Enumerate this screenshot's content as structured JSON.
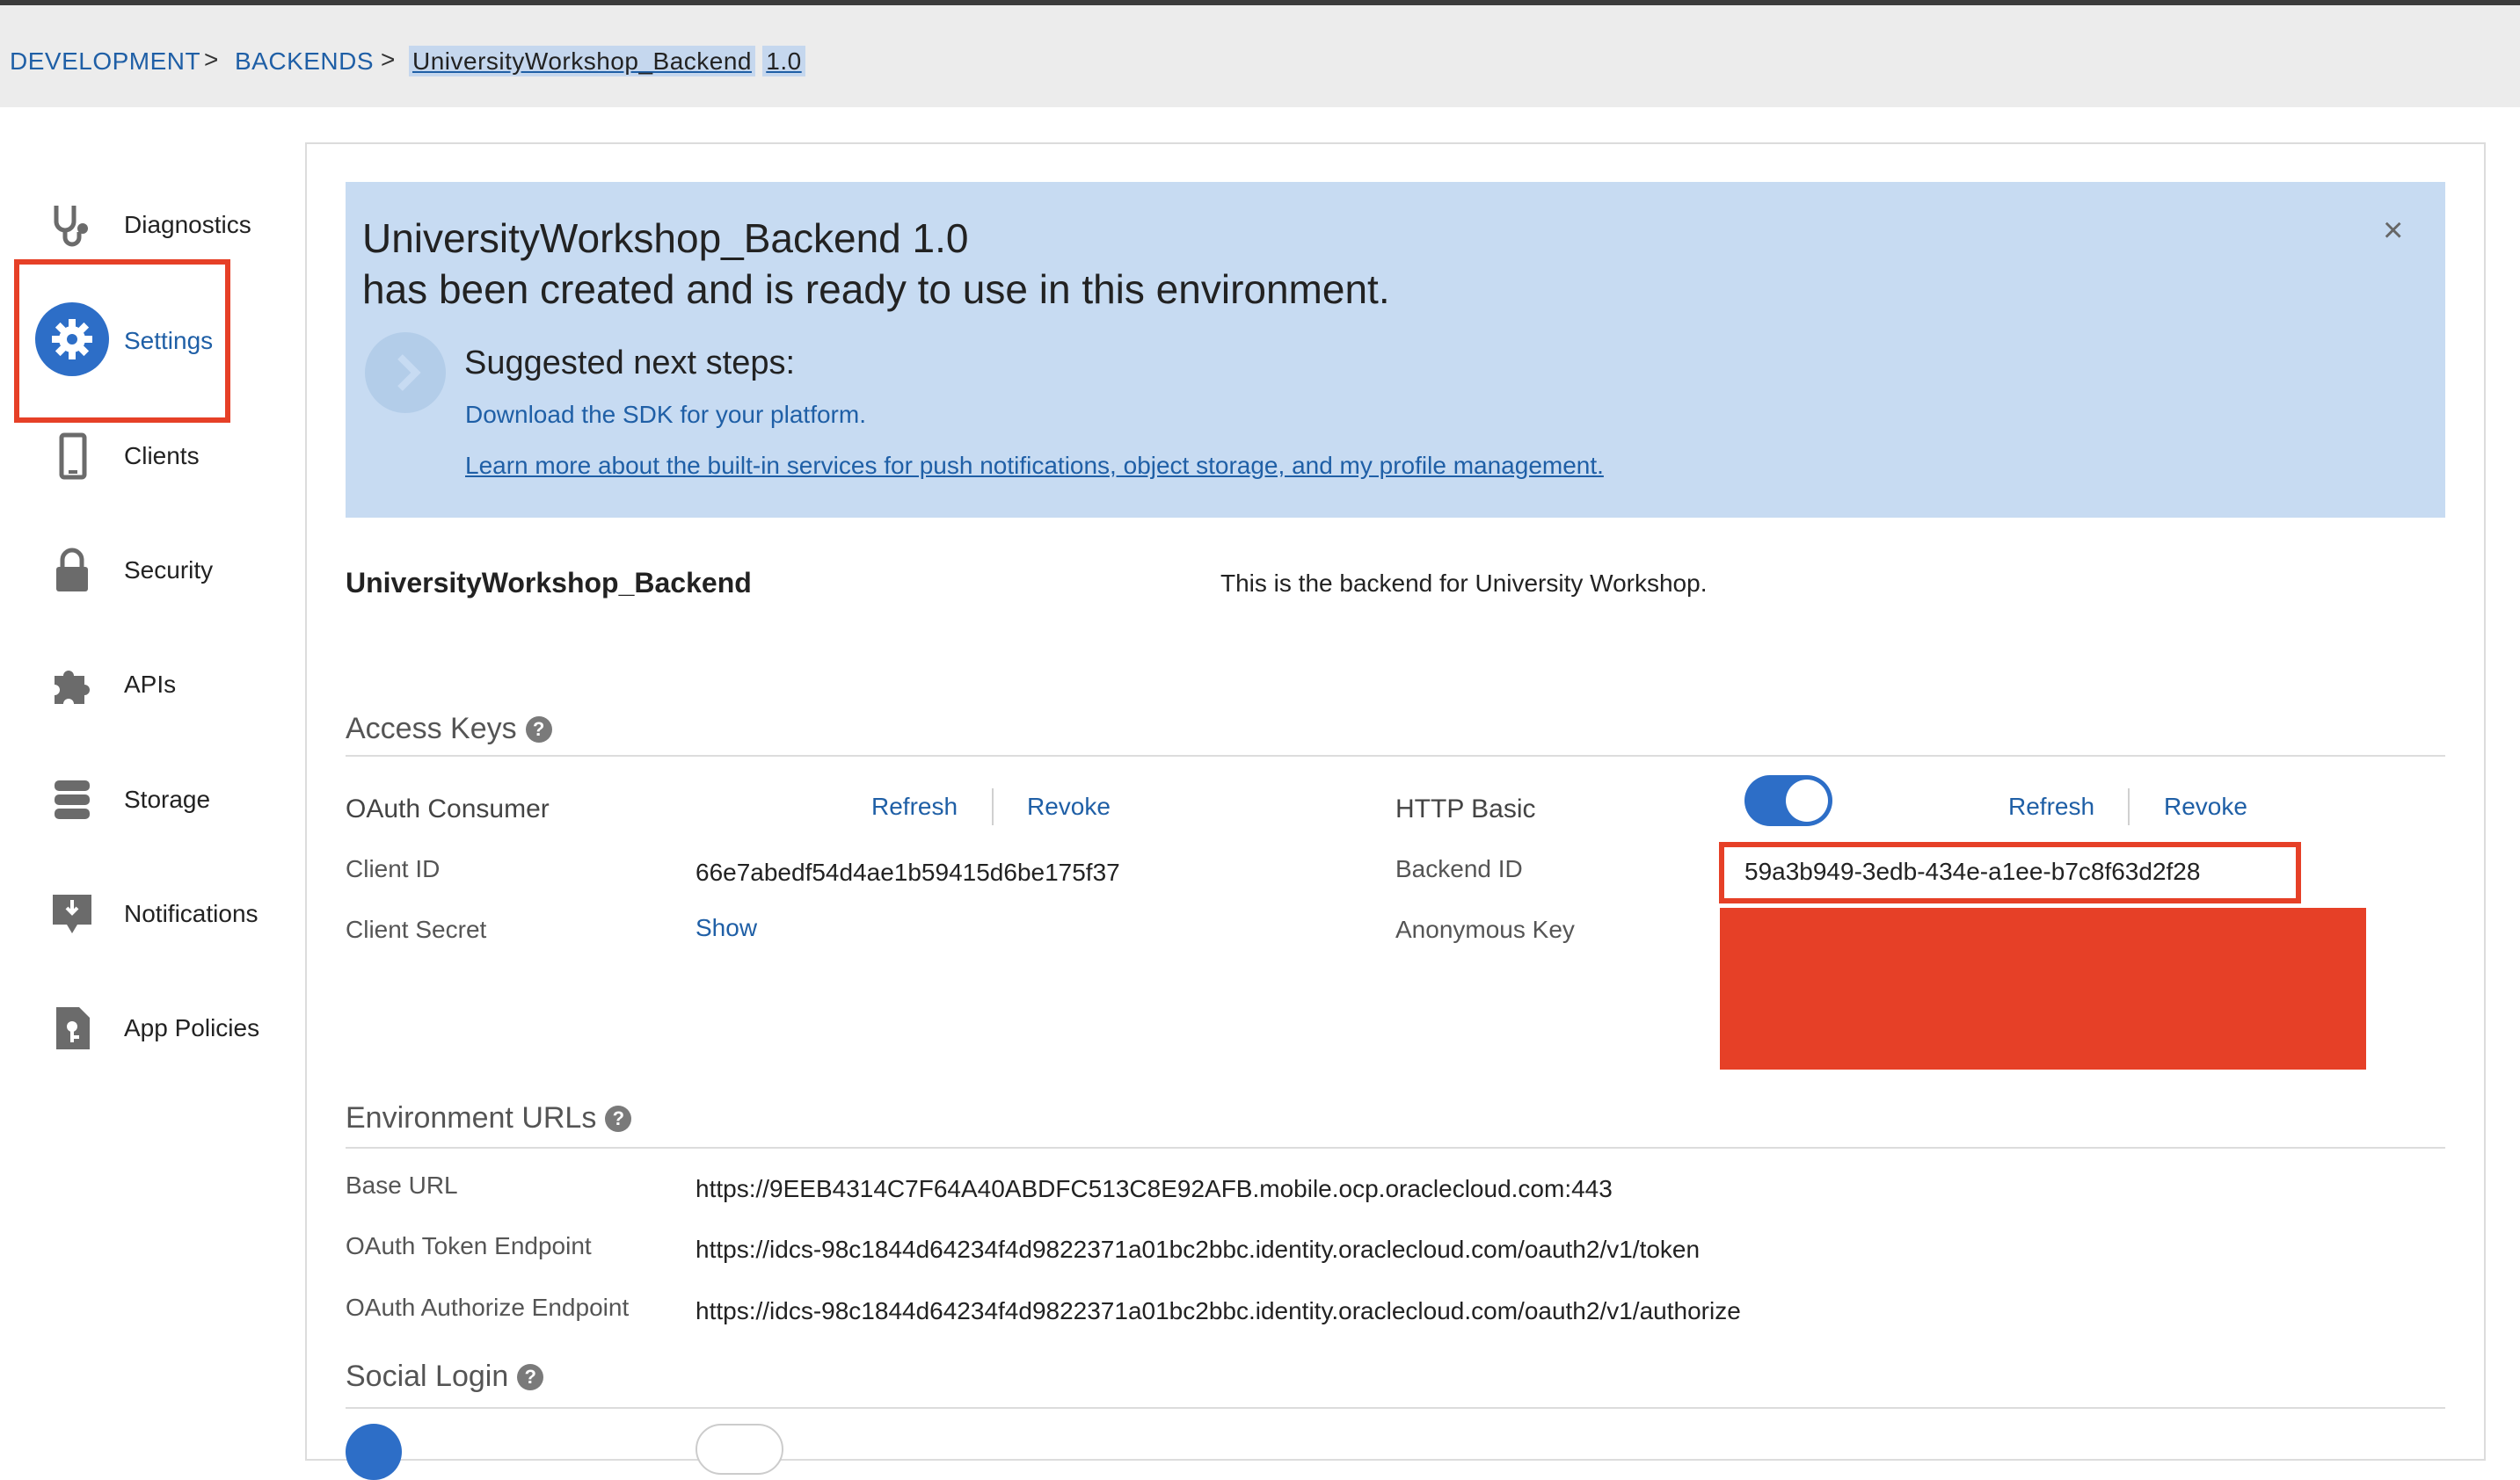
{
  "breadcrumb": {
    "items": [
      "DEVELOPMENT",
      "BACKENDS"
    ],
    "separator": ">",
    "current_name": "UniversityWorkshop_Backend",
    "current_version": "1.0"
  },
  "sidebar": {
    "items": [
      {
        "label": "Diagnostics",
        "icon": "stethoscope-icon"
      },
      {
        "label": "Settings",
        "icon": "gear-icon",
        "active": true
      },
      {
        "label": "Clients",
        "icon": "phone-icon"
      },
      {
        "label": "Security",
        "icon": "lock-icon"
      },
      {
        "label": "APIs",
        "icon": "puzzle-icon"
      },
      {
        "label": "Storage",
        "icon": "database-icon"
      },
      {
        "label": "Notifications",
        "icon": "notification-icon"
      },
      {
        "label": "App Policies",
        "icon": "policy-document-icon"
      }
    ]
  },
  "banner": {
    "title_line1": "UniversityWorkshop_Backend 1.0",
    "title_line2": "has been created and is ready to use in this environment.",
    "close": "×",
    "next_steps_title": "Suggested next steps:",
    "link_sdk": "Download the SDK for your platform.",
    "link_learn": "Learn more about the built-in services for push notifications, object storage, and my profile management."
  },
  "backend": {
    "name": "UniversityWorkshop_Backend",
    "description": "This is the backend for University Workshop."
  },
  "access_keys": {
    "title": "Access Keys",
    "oauth_consumer_label": "OAuth Consumer",
    "refresh": "Refresh",
    "revoke": "Revoke",
    "client_id_label": "Client ID",
    "client_id": "66e7abedf54d4ae1b59415d6be175f37",
    "client_secret_label": "Client Secret",
    "show": "Show",
    "http_basic_label": "HTTP Basic",
    "http_basic_enabled": true,
    "backend_id_label": "Backend ID",
    "backend_id": "59a3b949-3edb-434e-a1ee-b7c8f63d2f28",
    "anonymous_key_label": "Anonymous Key"
  },
  "environment_urls": {
    "title": "Environment URLs",
    "base_url_label": "Base URL",
    "base_url": "https://9EEB4314C7F64A40ABDFC513C8E92AFB.mobile.ocp.oraclecloud.com:443",
    "token_label": "OAuth Token Endpoint",
    "token_url": "https://idcs-98c1844d64234f4d9822371a01bc2bbc.identity.oraclecloud.com/oauth2/v1/token",
    "authorize_label": "OAuth Authorize Endpoint",
    "authorize_url": "https://idcs-98c1844d64234f4d9822371a01bc2bbc.identity.oraclecloud.com/oauth2/v1/authorize"
  },
  "social_login": {
    "title": "Social Login"
  },
  "help_glyph": "?",
  "colors": {
    "accent": "#2d6ec7",
    "link": "#1f5fa6",
    "banner": "#c7dbf2",
    "highlight": "#e64027"
  }
}
